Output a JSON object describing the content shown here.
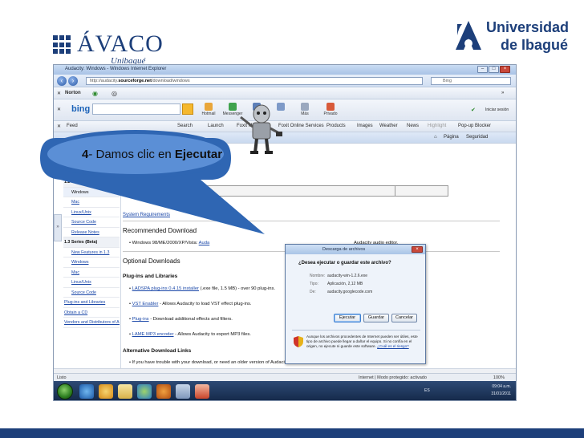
{
  "logos": {
    "avaco_name": "ÁVACO",
    "avaco_sub": "Unibagué",
    "university_line1": "Universidad",
    "university_line2": "de Ibagué"
  },
  "browser": {
    "title": "Audacity: Windows - Windows Internet Explorer",
    "url_prefix": "http://audacity.",
    "url_domain": "sourceforge.net",
    "url_path": "/download/windows",
    "search_placeholder": "Bing",
    "norton_label": "Norton",
    "bing_logo": "bing",
    "bing_sign_in": "Iniciar sesión",
    "toolbar_items": [
      "Hotmail",
      "Messenger",
      "",
      "",
      "Más",
      "Privado"
    ],
    "links_bar": {
      "feeds": "Feed",
      "search": "Search",
      "launch": "Launch",
      "foxit_media": "Foxit Media",
      "foxit_online": "Foxit Online Services",
      "products": "Products",
      "images": "Images",
      "weather": "Weather",
      "news": "News",
      "highlight": "Highlight",
      "popup_blocker": "Pop-up Blocker"
    },
    "tab_label": "Página",
    "tab_security": "Seguridad",
    "status_left": "Listo",
    "status_middle": "Internet | Modo protegido: activado",
    "status_zoom": "100%"
  },
  "sidebar": {
    "items": [
      {
        "label": "1.2 Series",
        "kind": "header"
      },
      {
        "label": "Windows",
        "kind": "selected"
      },
      {
        "label": "Mac",
        "kind": "link"
      },
      {
        "label": "Linux/Unix",
        "kind": "link"
      },
      {
        "label": "Source Code",
        "kind": "link"
      },
      {
        "label": "Release Notes",
        "kind": "link"
      },
      {
        "label": "1.3 Series (Beta)",
        "kind": "header"
      },
      {
        "label": "New Features in 1.3",
        "kind": "link"
      },
      {
        "label": "Windows",
        "kind": "link"
      },
      {
        "label": "Mac",
        "kind": "link"
      },
      {
        "label": "Linux/Unix",
        "kind": "link"
      },
      {
        "label": "Source Code",
        "kind": "link"
      },
      {
        "label": "Plug-ins and Libraries",
        "kind": "section"
      },
      {
        "label": "Obtain a CD",
        "kind": "section"
      },
      {
        "label": "Vendors and Distributors of Audacity",
        "kind": "section"
      }
    ]
  },
  "content": {
    "info_box": "See further information on",
    "system_requirements": "System Requirements",
    "recommended_download": "Recommended Download",
    "recommended_item": "Windows 98/ME/2000/XP/Vista:",
    "recommended_link": "Auda",
    "recommended_tail": "Audacity audio editor.",
    "optional_downloads": "Optional Downloads",
    "plugins_heading": "Plug-ins and Libraries",
    "bullets": [
      {
        "link": "LADSPA plug-ins 0.4.15 installer",
        "text": " (.exe file, 1.5 MB) - over 90 plug-ins."
      },
      {
        "link": "VST Enabler",
        "text": " - Allows Audacity to load VST effect plug-ins."
      },
      {
        "link": "Plug-ins",
        "text": " - Download additional effects and filters."
      },
      {
        "link": "LAME MP3 encoder",
        "text": " - Allows Audacity to export MP3 files."
      }
    ],
    "alternative_links": "Alternative Download Links",
    "alternative_text": "If you have trouble with your download, or need an older version of Audacity, try our alternate download links."
  },
  "dialog": {
    "title": "Descarga de archivos",
    "question": "¿Desea ejecutar o guardar este archivo?",
    "rows": [
      {
        "key": "Nombre:",
        "value": "audacity-win-1.2.6.exe"
      },
      {
        "key": "Tipo:",
        "value": "Aplicación, 2,12 MB"
      },
      {
        "key": "De:",
        "value": "audacity.googlecode.com"
      }
    ],
    "run_button": "Ejecutar",
    "save_button": "Guardar",
    "cancel_button": "Cancelar",
    "warning_text": "Aunque los archivos procedentes de Internet pueden ser útiles, este tipo de archivo puede llegar a dañar el equipo. Si no confía en el origen, no ejecute ni guarde este software. ",
    "warning_link": "¿Cuál es el riesgo?"
  },
  "taskbar": {
    "tray_number": "ES",
    "time": "09:04 a.m.",
    "date": "31/01/2011"
  },
  "callout": {
    "step_number": "4",
    "text": "- Damos clic en ",
    "bold_word": "Ejecutar"
  },
  "colors": {
    "brand_blue": "#1d3f7a",
    "callout_fill": "#2f66b3",
    "callout_inner": "#5b8fd6"
  }
}
